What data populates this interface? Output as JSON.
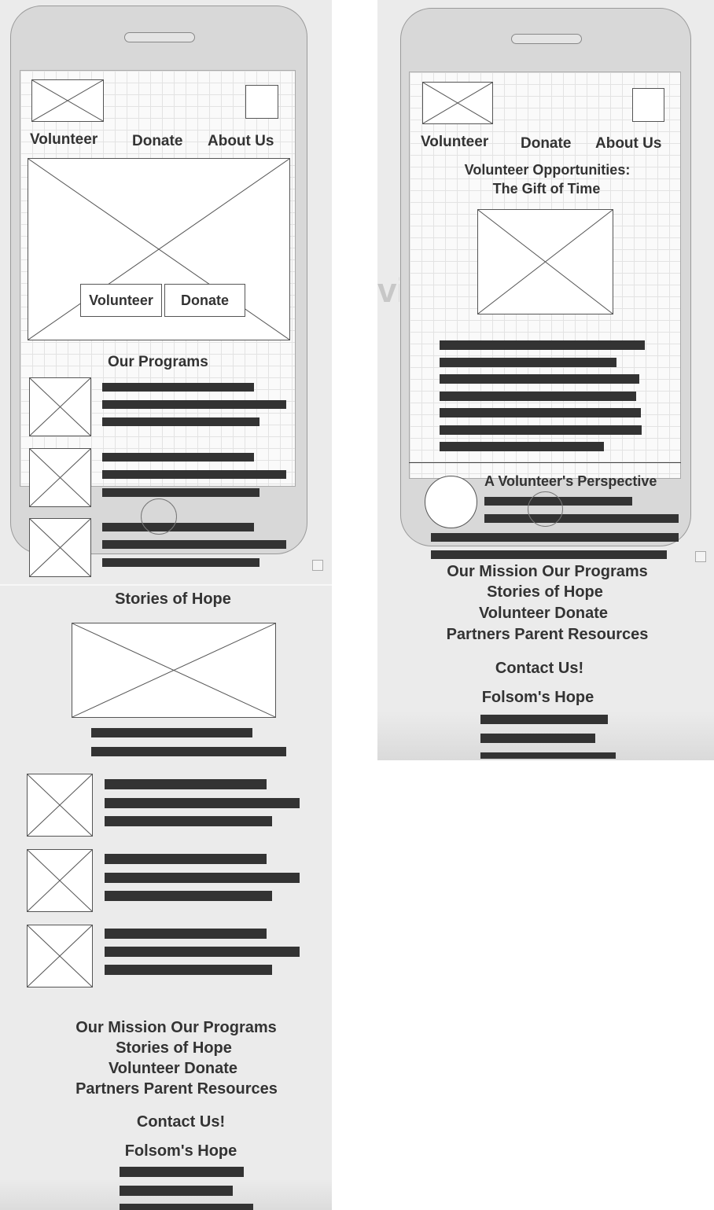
{
  "left_mockup": {
    "nav": {
      "volunteer": "Volunteer",
      "donate": "Donate",
      "about": "About Us"
    },
    "hero_buttons": {
      "volunteer": "Volunteer",
      "donate": "Donate"
    },
    "programs_heading": "Our Programs",
    "stories_heading": "Stories of Hope",
    "footer": {
      "links_line1": "Our Mission Our Programs",
      "links_line2": "Stories of Hope",
      "links_line3": "Volunteer Donate",
      "links_line4": "Partners Parent Resources",
      "contact": "Contact Us!",
      "brand": "Folsom's Hope"
    }
  },
  "right_mockup": {
    "nav": {
      "volunteer": "Volunteer",
      "donate": "Donate",
      "about": "About Us"
    },
    "heading_line1": "Volunteer Opportunities:",
    "heading_line2": "The Gift of Time",
    "perspective_heading": "A Volunteer's Perspective",
    "footer": {
      "links_line1": "Our Mission Our Programs",
      "links_line2": "Stories of Hope",
      "links_line3": "Volunteer Donate",
      "links_line4": "Partners Parent Resources",
      "contact": "Contact Us!",
      "brand": "Folsom's Hope"
    }
  },
  "icons": {
    "placeholder": "image-placeholder-icon",
    "expand": "expand-icon"
  }
}
